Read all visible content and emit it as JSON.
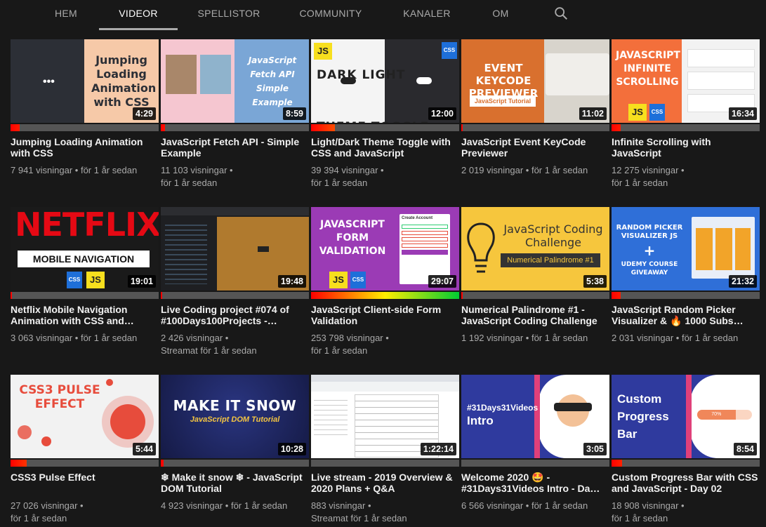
{
  "tabs": [
    {
      "label": "HEM"
    },
    {
      "label": "VIDEOR"
    },
    {
      "label": "SPELLISTOR"
    },
    {
      "label": "COMMUNITY"
    },
    {
      "label": "KANALER"
    },
    {
      "label": "OM"
    }
  ],
  "active_tab": "VIDEOR",
  "colors": {
    "background": "#181818",
    "progress_track": "#555555",
    "accent_gradient": [
      "#ff0000",
      "#ffee00",
      "#00cc33"
    ]
  },
  "videos": [
    {
      "title": "Jumping Loading Animation with CSS",
      "views": "7 941 visningar",
      "age": "för 1 år sedan",
      "duration": "4:29",
      "thumb_text": "Jumping Loading Animation with CSS",
      "watched": 0.06
    },
    {
      "title": "JavaScript Fetch API - Simple Example",
      "views": "11 103 visningar",
      "age": "för 1 år sedan",
      "duration": "8:59",
      "thumb_text": "JavaScript Fetch API Simple Example",
      "watched": 0.03
    },
    {
      "title": "Light/Dark Theme Toggle with CSS and JavaScript",
      "views": "39 394 visningar",
      "age": "för 1 år sedan",
      "duration": "12:00",
      "thumb_text": "DARK LIGHT THEME TOGGLE",
      "watched": 0.16
    },
    {
      "title": "JavaScript Event KeyCode Previewer",
      "views": "2 019 visningar",
      "age": "för 1 år sedan",
      "duration": "11:02",
      "thumb_text": "EVENT KEYCODE PREVIEWER",
      "thumb_sub": "JavaScript Tutorial",
      "watched": 0.01
    },
    {
      "title": "Infinite Scrolling with JavaScript",
      "views": "12 275 visningar",
      "age": "för 1 år sedan",
      "duration": "16:34",
      "thumb_text": "JAVASCRIPT INFINITE SCROLLING",
      "watched": 0.06
    },
    {
      "title": "Netflix Mobile Navigation Animation with CSS and…",
      "views": "3 063 visningar",
      "age": "för 1 år sedan",
      "duration": "19:01",
      "thumb_text": "NETFLIX",
      "thumb_sub": "MOBILE NAVIGATION",
      "watched": 0.01
    },
    {
      "title": "Live Coding project #074 of #100Days100Projects -…",
      "views": "2 426 visningar",
      "age": "Streamat för 1 år sedan",
      "duration": "19:48",
      "watched": 0.01
    },
    {
      "title": "JavaScript Client-side Form Validation",
      "views": "253 798 visningar",
      "age": "för 1 år sedan",
      "duration": "29:07",
      "thumb_text": "JAVASCRIPT FORM VALIDATION",
      "thumb_sub": "Create Account",
      "watched": 1.0
    },
    {
      "title": "Numerical Palindrome #1 - JavaScript Coding Challenge",
      "views": "1 192 visningar",
      "age": "för 1 år sedan",
      "duration": "5:38",
      "thumb_text": "JavaScript Coding Challenge",
      "thumb_sub": "Numerical Palindrome #1",
      "watched": 0.01
    },
    {
      "title": "JavaScript Random Picker Visualizer & 🔥 1000 Subs…",
      "views": "2 031 visningar",
      "age": "för 1 år sedan",
      "duration": "21:32",
      "thumb_text": "RANDOM PICKER VISUALIZER JS",
      "thumb_sub": "UDEMY COURSE GIVEAWAY",
      "watched": 0.06
    },
    {
      "title": "CSS3 Pulse Effect",
      "views": "27 026 visningar",
      "age": "för 1 år sedan",
      "duration": "5:44",
      "thumb_text": "CSS3 PULSE EFFECT",
      "watched": 0.11
    },
    {
      "title": "❄ Make it snow ❄ - JavaScript DOM Tutorial",
      "views": "4 923 visningar",
      "age": "för 1 år sedan",
      "duration": "10:28",
      "thumb_text": "MAKE IT SNOW",
      "thumb_sub": "JavaScript DOM Tutorial",
      "watched": 0.02
    },
    {
      "title": "Live stream - 2019 Overview & 2020 Plans + Q&A",
      "views": "883 visningar",
      "age": "Streamat för 1 år sedan",
      "duration": "1:22:14",
      "watched": 0.0
    },
    {
      "title": "Welcome 2020 🤩 - #31Days31Videos Intro - Da…",
      "views": "6 566 visningar",
      "age": "för 1 år sedan",
      "duration": "3:05",
      "thumb_text": "#31Days31Videos",
      "thumb_sub": "Intro",
      "watched": 0.0
    },
    {
      "title": "Custom Progress Bar with CSS and JavaScript - Day 02",
      "views": "18 908 visningar",
      "age": "för 1 år sedan",
      "duration": "8:54",
      "thumb_text": "Custom Progress Bar",
      "thumb_sub": "70%",
      "watched": 0.07
    }
  ]
}
